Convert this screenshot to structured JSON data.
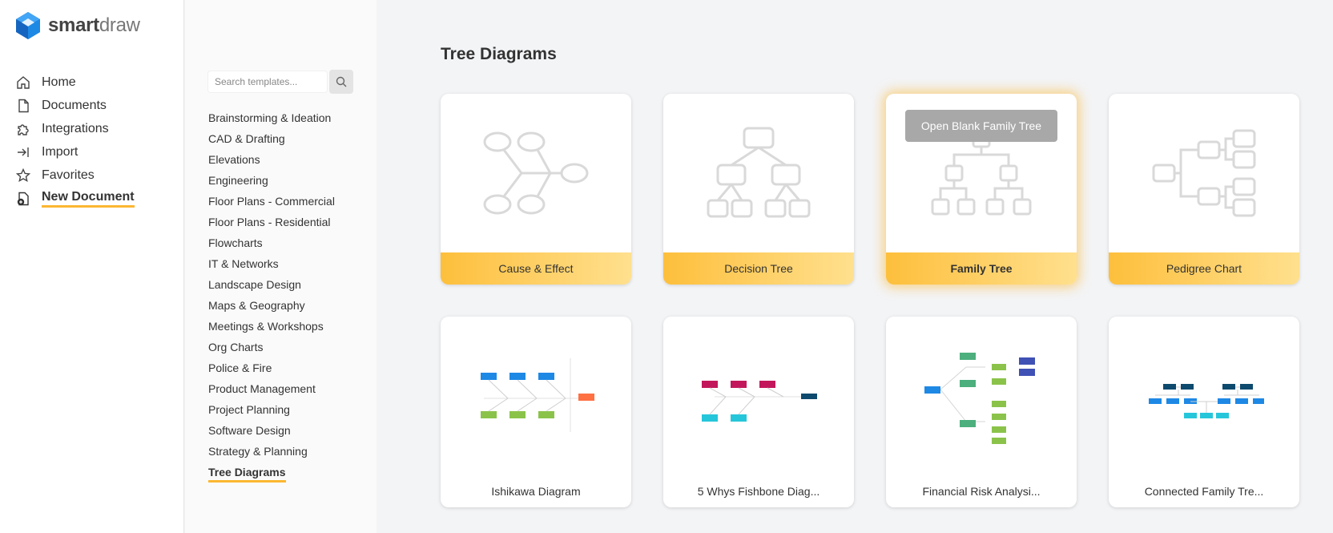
{
  "brand": {
    "name_bold": "smart",
    "name_light": "draw"
  },
  "nav": {
    "items": [
      {
        "label": "Home",
        "icon": "home-icon"
      },
      {
        "label": "Documents",
        "icon": "document-icon"
      },
      {
        "label": "Integrations",
        "icon": "puzzle-icon"
      },
      {
        "label": "Import",
        "icon": "import-icon"
      },
      {
        "label": "Favorites",
        "icon": "star-icon"
      },
      {
        "label": "New Document",
        "icon": "new-document-icon",
        "active": true
      }
    ]
  },
  "search": {
    "placeholder": "Search templates..."
  },
  "categories": [
    "Brainstorming & Ideation",
    "CAD & Drafting",
    "Elevations",
    "Engineering",
    "Floor Plans - Commercial",
    "Floor Plans - Residential",
    "Flowcharts",
    "IT & Networks",
    "Landscape Design",
    "Maps & Geography",
    "Meetings & Workshops",
    "Org Charts",
    "Police & Fire",
    "Product Management",
    "Project Planning",
    "Software Design",
    "Strategy & Planning",
    "Tree Diagrams"
  ],
  "active_category": "Tree Diagrams",
  "page": {
    "title": "Tree Diagrams"
  },
  "blank_templates": [
    {
      "label": "Cause & Effect"
    },
    {
      "label": "Decision Tree"
    },
    {
      "label": "Family Tree",
      "hover_button": "Open Blank Family Tree",
      "highlighted": true
    },
    {
      "label": "Pedigree Chart"
    }
  ],
  "example_templates": [
    {
      "label": "Ishikawa Diagram"
    },
    {
      "label": "5 Whys Fishbone Diag..."
    },
    {
      "label": "Financial Risk Analysi..."
    },
    {
      "label": "Connected Family Tre..."
    }
  ],
  "colors": {
    "accent": "#fbb731",
    "card_bar_start": "#fdbf3c",
    "card_bar_end": "#ffe08e",
    "logo_blue": "#1e88e5"
  }
}
